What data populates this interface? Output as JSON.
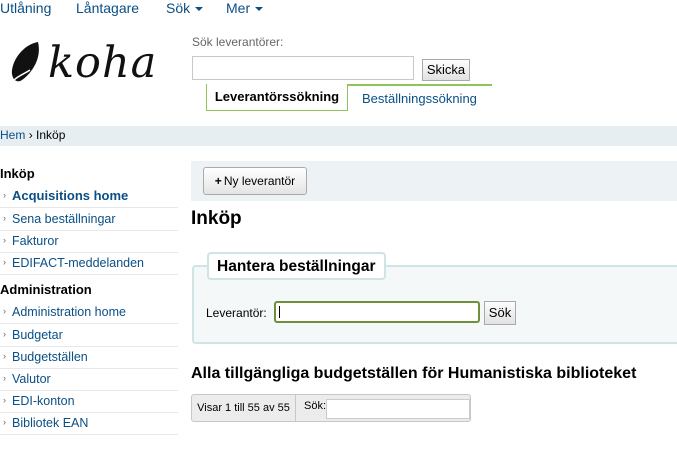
{
  "nav": {
    "items": [
      {
        "label": "Utlåning",
        "has_caret": false
      },
      {
        "label": "Låntagare",
        "has_caret": false
      },
      {
        "label": "Sök",
        "has_caret": true
      },
      {
        "label": "Mer",
        "has_caret": true
      }
    ]
  },
  "logo": {
    "text": "koha"
  },
  "search": {
    "label": "Sök leverantörer:",
    "value": "",
    "submit_label": "Skicka",
    "tabs": [
      {
        "label": "Leverantörssökning",
        "active": true
      },
      {
        "label": "Beställningssökning",
        "active": false
      }
    ]
  },
  "breadcrumb": {
    "home": "Hem",
    "separator": "›",
    "current": "Inköp"
  },
  "sidebar": {
    "sections": [
      {
        "heading": "Inköp",
        "items": [
          "Acquisitions home",
          "Sena beställningar",
          "Fakturor",
          "EDIFACT-meddelanden"
        ]
      },
      {
        "heading": "Administration",
        "items": [
          "Administration home",
          "Budgetar",
          "Budgetställen",
          "Valutor",
          "EDI-konton",
          "Bibliotek EAN"
        ]
      }
    ]
  },
  "toolbar": {
    "new_vendor_label": "Ny leverantör"
  },
  "page": {
    "title": "Inköp"
  },
  "manage_orders": {
    "legend": "Hantera beställningar",
    "supplier_label": "Leverantör:",
    "supplier_value": "",
    "search_button": "Sök"
  },
  "funds": {
    "heading": "Alla tillgängliga budgetställen för Humanistiska biblioteket",
    "info": "Visar 1 till 55 av 55",
    "search_label": "Sök:",
    "search_value": ""
  },
  "colors": {
    "link": "#0a4f86",
    "accent_green": "#8ec45a",
    "breadcrumb_bg": "#e6eef1"
  }
}
